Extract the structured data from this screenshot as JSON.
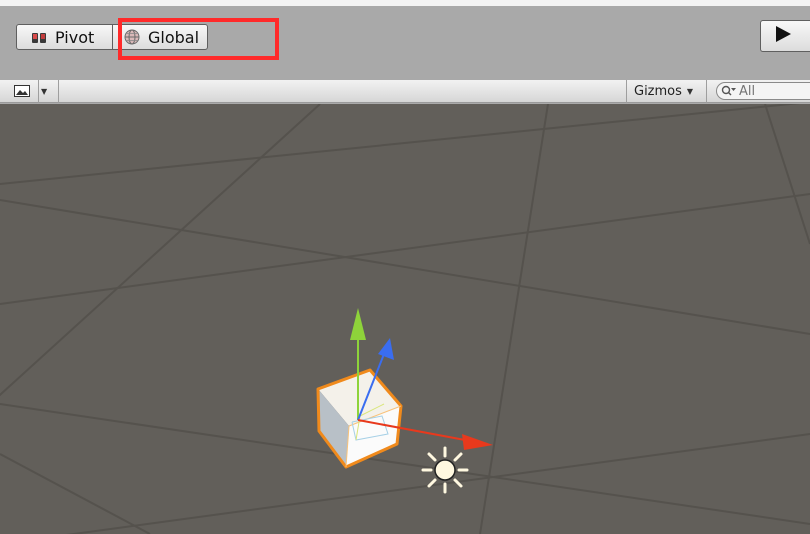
{
  "toolbar": {
    "pivot_label": "Pivot",
    "global_label": "Global",
    "play_icon": "play-icon",
    "pivot_icon": "pivot-mode-icon",
    "global_icon": "global-space-icon"
  },
  "scene_toolbar": {
    "draw_mode_icon": "image-icon",
    "gizmos_label": "Gizmos",
    "search_placeholder": "All"
  },
  "scene": {
    "background_color": "#625f5a",
    "selection_outline_color": "#f08a1c",
    "axis_colors": {
      "x": "#e8391d",
      "y": "#8ed33a",
      "z": "#3a6df0"
    }
  },
  "annotation": {
    "highlight_color": "#ff2a2a",
    "target": "global-button"
  }
}
